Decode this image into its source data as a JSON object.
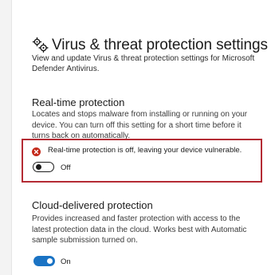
{
  "header": {
    "title": "Virus & threat protection settings",
    "subtitle": "View and update Virus & threat protection settings for Microsoft Defender Antivirus."
  },
  "realtime": {
    "title": "Real-time protection",
    "description": "Locates and stops malware from installing or running on your device. You can turn off this setting for a short time before it turns back on automatically.",
    "alert_text": "Real-time protection is off, leaving your device vulnerable.",
    "toggle_state": "Off",
    "toggle_on": false
  },
  "cloud": {
    "title": "Cloud-delivered protection",
    "description": "Provides increased and faster protection with access to the latest protection data in the cloud. Works best with Automatic sample submission turned on.",
    "toggle_state": "On",
    "toggle_on": true
  },
  "colors": {
    "alert_border": "#b42b34",
    "error_icon": "#c42b1c",
    "toggle_on": "#1a73c4"
  },
  "icons": {
    "header": "gear-settings-icon",
    "alert": "error-x-icon"
  }
}
